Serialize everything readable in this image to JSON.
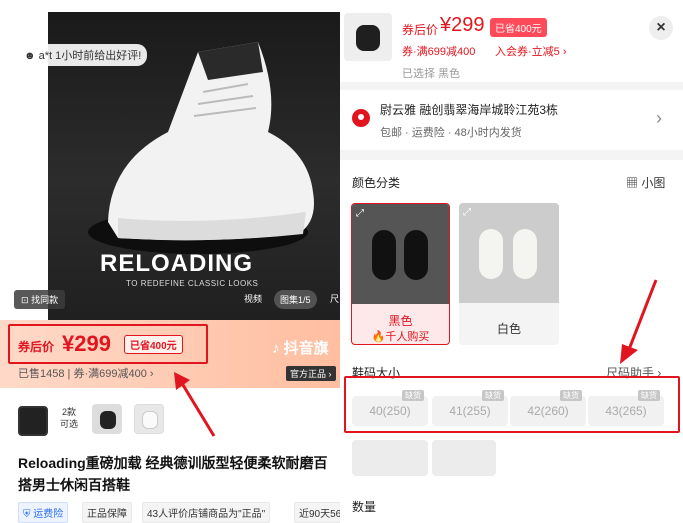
{
  "left": {
    "review_chip": "a*t 1小时前给出好评!",
    "hero_brand": "RELOADING",
    "hero_tagline": "TO REDEFINE CLASSIC LOOKS",
    "find_same": "找同款",
    "video_tab": "视频",
    "image_tab": "图集1/5",
    "next_tab": "尺",
    "price_label": "券后价",
    "price_value": "¥299",
    "saved_badge": "已省400元",
    "douyin_flag": "抖音旗",
    "sold_text": "已售1458 | 券·满699减400 ›",
    "official_badge": "官方正品 ›",
    "variant_count": "2款\n可选",
    "title": "Reloading重磅加载 经典德训版型轻便柔软耐磨百搭男士休闲百搭鞋",
    "tags": [
      "运费险",
      "正品保障",
      "43人评价店铺商品为\"正品\"",
      "近90天56"
    ]
  },
  "right": {
    "price_label": "券后价",
    "price_value": "¥299",
    "saved_badge": "已省400元",
    "coupon_text": "券·满699减400",
    "join_text": "入会券·立减5 ›",
    "selected_text": "已选择 黑色",
    "close_icon": "×",
    "address": "尉云雅  融创翡翠海岸城聆江苑3栋",
    "address_sub": "包邮 · 运费险 · 48小时内发货",
    "color_label": "颜色分类",
    "small_view": "小图",
    "colors": [
      {
        "name": "黑色",
        "sub": "千人购买"
      },
      {
        "name": "白色"
      }
    ],
    "size_label": "鞋码大小",
    "size_help": "尺码助手 ›",
    "sizes": [
      {
        "label": "40(250)",
        "tag": "缺货"
      },
      {
        "label": "41(255)",
        "tag": "缺货"
      },
      {
        "label": "42(260)",
        "tag": "缺货"
      },
      {
        "label": "43(265)",
        "tag": "缺货"
      }
    ],
    "qty_label": "数量"
  },
  "colors": {
    "accent": "#e0151f",
    "badge_bg": "#ff4a5a",
    "price_bar": "#ffbea0"
  }
}
